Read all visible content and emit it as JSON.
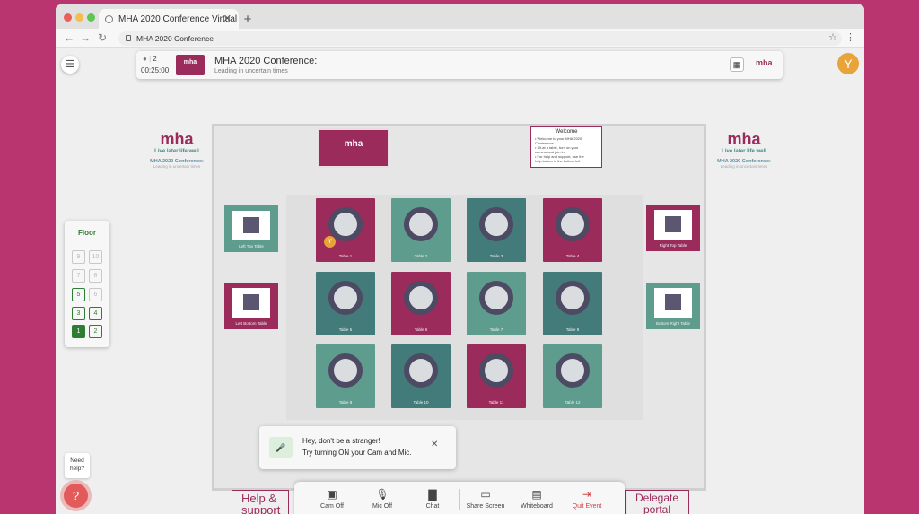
{
  "browser": {
    "tab_title": "MHA 2020 Conference Virtual C",
    "url": "MHA 2020 Conference"
  },
  "header": {
    "user_count": "2",
    "timer": "00:25:00",
    "title": "MHA 2020 Conference:",
    "subtitle": "Leading in uncertain times",
    "logo_text": "mha",
    "avatar_initial": "Y"
  },
  "brand": {
    "logo": "mha",
    "tagline": "Live later life well",
    "conference": "MHA 2020 Conference:",
    "conference_sub": "Leading in uncertain times"
  },
  "floor": {
    "title": "Floor",
    "levels": [
      "9",
      "10",
      "7",
      "8",
      "5",
      "6",
      "3",
      "4",
      "1",
      "2"
    ],
    "selected": "1"
  },
  "plan": {
    "banner_logo": "mha",
    "welcome": {
      "title": "Welcome",
      "lines": [
        "• Welcome to your MHA 2020",
        "Conference.",
        "• Sit at a table, turn on your",
        "camera and join in!",
        "• For help and support, use the",
        "help button in the bottom left"
      ]
    },
    "tables": [
      "Table 1",
      "Table 2",
      "Table 3",
      "Table 4",
      "Table 5",
      "Table 6",
      "Table 7",
      "Table 8",
      "Table 9",
      "Table 10",
      "Table 11",
      "Table 12"
    ],
    "side_tables": {
      "left_top": "Left Top Table",
      "left_bottom": "Left Bottom Table",
      "right_top": "Right Top Table",
      "right_bottom": "Bottom Right Table"
    },
    "help_sign": "Help & support",
    "delegate_sign": "Delegate portal"
  },
  "toast": {
    "line1": "Hey, don't be a stranger!",
    "line2": "Try turning ON your Cam and Mic."
  },
  "controls": {
    "cam": "Cam Off",
    "mic": "Mic Off",
    "chat": "Chat",
    "share": "Share Screen",
    "whiteboard": "Whiteboard",
    "quit": "Quit Event"
  },
  "help": {
    "bubble": "Need help?"
  },
  "colors": {
    "magenta": "#9b2b5a",
    "teal": "#5e9c8d",
    "green": "#2e7d32",
    "background": "#b8356f"
  }
}
